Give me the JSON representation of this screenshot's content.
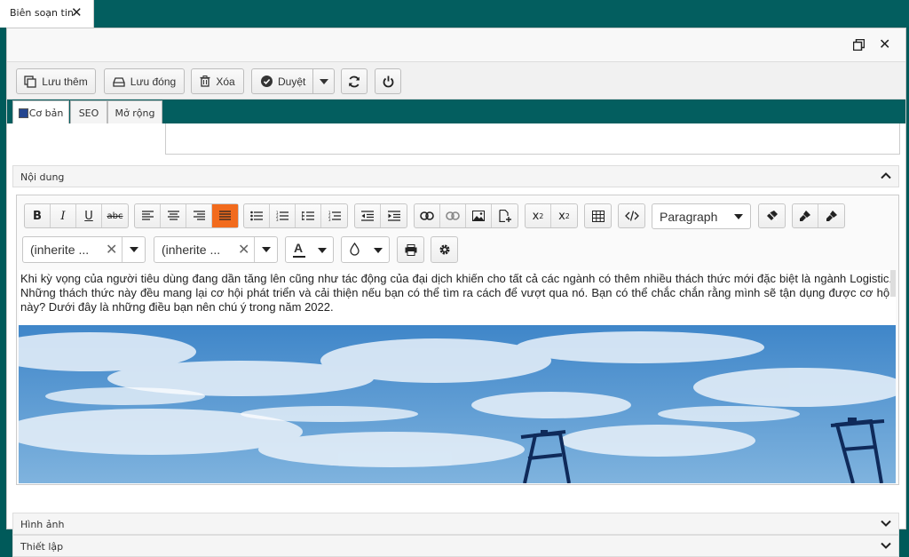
{
  "doc_tab": {
    "label": "Biên soạn tin",
    "close_icon": "close-icon"
  },
  "toolbar": {
    "save_more": "Lưu thêm",
    "save_close": "Lưu đóng",
    "delete": "Xóa",
    "approve": "Duyệt"
  },
  "tabs": [
    "Cơ bản",
    "SEO",
    "Mở rộng"
  ],
  "panels": {
    "content": "Nội dung",
    "images": "Hình ảnh",
    "settings": "Thiết lập"
  },
  "editor": {
    "format_select": "Paragraph",
    "font_family": "(inherite ...",
    "font_size": "(inherite ...",
    "font_color_letter": "A",
    "body_text": "Khi kỳ vọng của người tiêu dùng đang dần tăng lên cũng như tác động của đại dịch khiến cho tất cả các ngành có thêm nhiều thách thức mới đặc biệt là ngành Logistic. Những thách thức này đều mang lại cơ hội phát triển và cải thiện nếu bạn có thể tìm ra cách để vượt qua nó. Bạn có thể chắc chắn rằng mình sẽ tận dụng được cơ hội này? Dưới đây là những điều bạn nên chú ý trong năm 2022."
  },
  "colors": {
    "brand": "#035e5f",
    "active_tool": "#f26b1d"
  }
}
